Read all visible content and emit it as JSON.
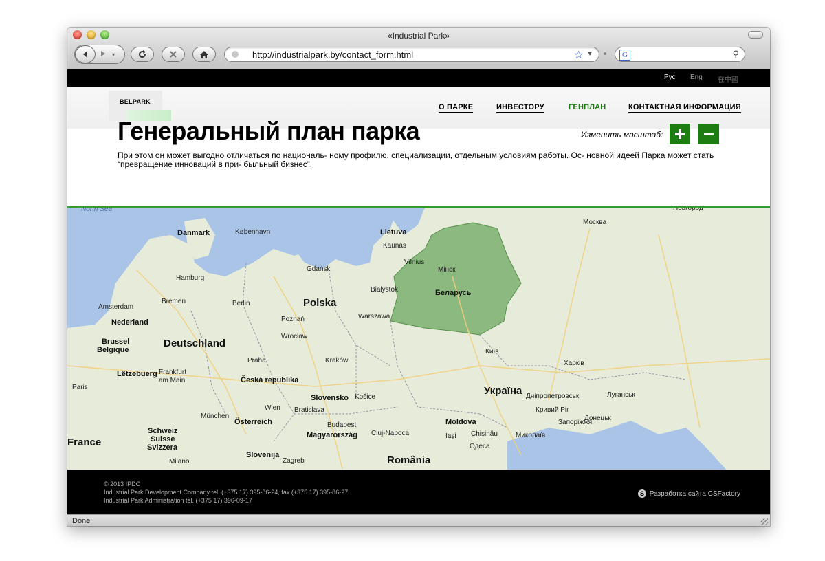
{
  "browser": {
    "window_title": "«Industrial Park»",
    "url": "http://industrialpark.by/contact_form.html",
    "search_placeholder": "",
    "search_engine_icon": "G",
    "status": "Done"
  },
  "languages": [
    {
      "label": "Рус",
      "color": "#ffffff"
    },
    {
      "label": "Eng",
      "color": "#9a9a9a"
    },
    {
      "label": "在中國",
      "color": "#6a6a6a"
    }
  ],
  "site": {
    "logo": "BELPARK",
    "nav": [
      {
        "label": "О ПАРКЕ"
      },
      {
        "label": "ИНВЕСТОРУ"
      },
      {
        "label": "ГЕНПЛАН",
        "active": true
      },
      {
        "label": "КОНТАКТНАЯ ИНФОРМАЦИЯ"
      }
    ],
    "accent_color": "#1d7d12"
  },
  "page": {
    "title": "Генеральный план парка",
    "description": "При этом он может выгодно отличаться по националь- ному профилю, специализации, отдельным условиям работы. Ос- новной идеей Парка может стать “превращение инноваций в при- быльный бизнес”.",
    "scale_label": "Изменить масштаб:",
    "zoom_in": "+",
    "zoom_out": "−"
  },
  "map": {
    "labels": {
      "north_sea": "North Sea",
      "danmark": "Danmark",
      "kobenhavn": "København",
      "lietuva": "Lietuva",
      "kaunas": "Kaunas",
      "vilnius": "Vilnius",
      "minsk": "Мінск",
      "belarus": "Беларусь",
      "moskva": "Москва",
      "novgorod": "Новгород",
      "hamburg": "Hamburg",
      "gdansk": "Gdańsk",
      "bialystok": "Białystok",
      "amsterdam": "Amsterdam",
      "bremen": "Bremen",
      "berlin": "Berlin",
      "polska": "Polska",
      "nederland": "Nederland",
      "poznan": "Poznań",
      "warszawa": "Warszawa",
      "brussel": "Brussel",
      "belgique": "Belgique",
      "deutschland": "Deutschland",
      "wroclaw": "Wrocław",
      "kyiv": "Київ",
      "kharkiv": "Харків",
      "praha": "Praha",
      "krakow": "Kraków",
      "letzebuerg": "Lëtzebuerg",
      "frankfurt": "Frankfurt am Main",
      "ceska": "Česká republika",
      "ukraina": "Україна",
      "dnipro": "Дніпропетровськ",
      "luhansk": "Луганськ",
      "paris": "Paris",
      "slovensko": "Slovensko",
      "kosice": "Košice",
      "wien": "Wien",
      "bratislava": "Bratislava",
      "kryvyi": "Кривий Ріг",
      "zaporizhia": "Запоріжжя",
      "muenchen": "München",
      "osterreich": "Österreich",
      "budapest": "Budapest",
      "moldova": "Moldova",
      "donetsk": "Донецьк",
      "france": "France",
      "schweiz": "Schweiz",
      "suisse": "Suisse",
      "svizzera": "Svizzera",
      "magyarorszag": "Magyarország",
      "cluj": "Cluj-Napoca",
      "iasi": "Iași",
      "chisinau": "Chișinău",
      "mykolaiv": "Миколаїв",
      "odesa": "Одеса",
      "milano": "Milano",
      "slovenija": "Slovenija",
      "zagreb": "Zagreb",
      "romania": "România"
    }
  },
  "footer": {
    "copyright": "© 2013  IPDC",
    "line1": "Industrial Park Development Company tel. (+375 17) 395-86-24, fax (+375 17) 395-86-27",
    "line2": "Industrial Park Administration tel. (+375 17) 396-09-17",
    "credit": "Разработка сайта CSFactory",
    "credit_icon": "S"
  }
}
